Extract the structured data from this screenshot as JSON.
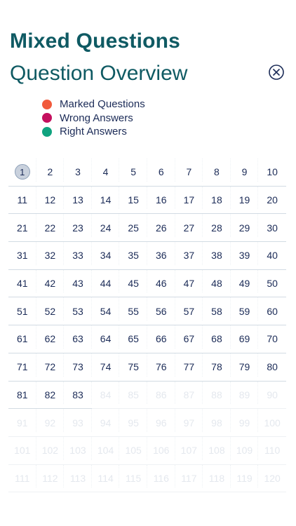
{
  "header": {
    "title": "Mixed Questions",
    "subtitle": "Question Overview"
  },
  "close_icon": "close-circle-x-icon",
  "legend": [
    {
      "label": "Marked Questions",
      "color": "#f15a3c"
    },
    {
      "label": "Wrong Answers",
      "color": "#c4105e"
    },
    {
      "label": "Right Answers",
      "color": "#10a37f"
    }
  ],
  "grid": {
    "current_question": 1,
    "answered_up_to": 83,
    "numbers": [
      "1",
      "2",
      "3",
      "4",
      "5",
      "6",
      "7",
      "8",
      "9",
      "10",
      "11",
      "12",
      "13",
      "14",
      "15",
      "16",
      "17",
      "18",
      "19",
      "20",
      "21",
      "22",
      "23",
      "24",
      "25",
      "26",
      "27",
      "28",
      "29",
      "30",
      "31",
      "32",
      "33",
      "34",
      "35",
      "36",
      "37",
      "38",
      "39",
      "40",
      "41",
      "42",
      "43",
      "44",
      "45",
      "46",
      "47",
      "48",
      "49",
      "50",
      "51",
      "52",
      "53",
      "54",
      "55",
      "56",
      "57",
      "58",
      "59",
      "60",
      "61",
      "62",
      "63",
      "64",
      "65",
      "66",
      "67",
      "68",
      "69",
      "70",
      "71",
      "72",
      "73",
      "74",
      "75",
      "76",
      "77",
      "78",
      "79",
      "80",
      "81",
      "82",
      "83",
      "84",
      "85",
      "86",
      "87",
      "88",
      "89",
      "90",
      "91",
      "92",
      "93",
      "94",
      "95",
      "96",
      "97",
      "98",
      "99",
      "100",
      "101",
      "102",
      "103",
      "104",
      "105",
      "106",
      "107",
      "108",
      "109",
      "110",
      "111",
      "112",
      "113",
      "114",
      "115",
      "116",
      "117",
      "118",
      "119",
      "120"
    ]
  },
  "colors": {
    "heading": "#0f5a63",
    "text": "#1b2b57",
    "disabled_text": "#e4e8ee",
    "current_fill": "#c9d1dd"
  }
}
